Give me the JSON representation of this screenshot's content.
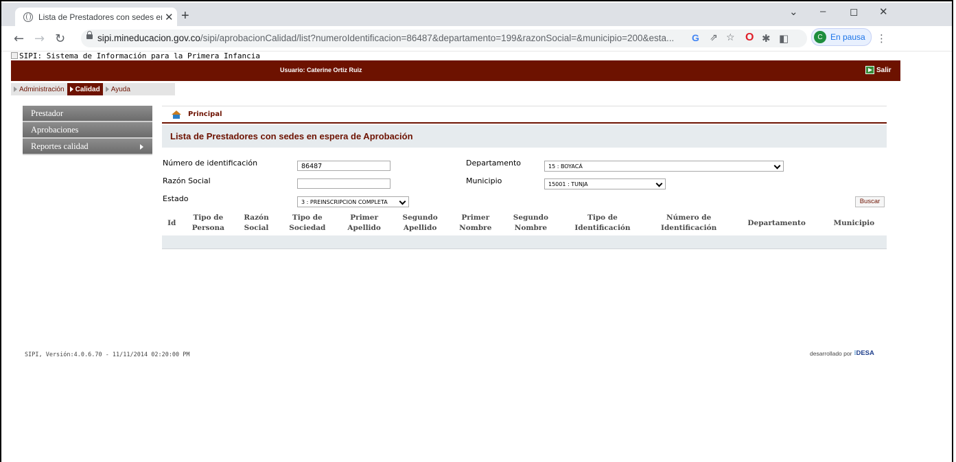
{
  "browser": {
    "tab_title": "Lista de Prestadores con sedes en",
    "tab_close": "✕",
    "new_tab": "+",
    "win_minimize": "–",
    "win_restore": "◻",
    "win_close": "✕",
    "win_chevron": "⌄",
    "url_host": "sipi.mineducacion.gov.co",
    "url_path": "/sipi/aprobacionCalidad/list?numeroIdentificacion=86487&departamento=199&razonSocial=&municipio=200&esta...",
    "profile_initial": "C",
    "profile_status": "En pausa"
  },
  "page": {
    "banner_alt": "SIPI: Sistema de Información para la Primera Infancia",
    "user_label": "Usuario: Caterine Ortiz Ruiz",
    "salir": "Salir",
    "menu": [
      {
        "label": "Administración",
        "active": false
      },
      {
        "label": "Calidad",
        "active": true
      },
      {
        "label": "Ayuda",
        "active": false
      }
    ],
    "sidebar": [
      {
        "label": "Prestador"
      },
      {
        "label": "Aprobaciones"
      },
      {
        "label": "Reportes calidad",
        "has_submenu": true
      }
    ],
    "breadcrumb": "Principal",
    "title": "Lista de Prestadores con sedes en espera de Aprobación",
    "form": {
      "numero_label": "Número de identificación",
      "numero_value": "86487",
      "razon_label": "Razón Social",
      "razon_value": "",
      "estado_label": "Estado",
      "estado_value": "3 : PREINSCRIPCION COMPLETA",
      "departamento_label": "Departamento",
      "departamento_value": "15 : BOYACÁ",
      "municipio_label": "Municipio",
      "municipio_value": "15001 : TUNJA",
      "buscar": "Buscar"
    },
    "table": {
      "columns": [
        [
          "Id"
        ],
        [
          "Tipo de",
          "Persona"
        ],
        [
          "Razón",
          "Social"
        ],
        [
          "Tipo de",
          "Sociedad"
        ],
        [
          "Primer",
          "Apellido"
        ],
        [
          "Segundo",
          "Apellido"
        ],
        [
          "Primer",
          "Nombre"
        ],
        [
          "Segundo",
          "Nombre"
        ],
        [
          "Tipo de",
          "Identificación"
        ],
        [
          "Número de",
          "Identificación"
        ],
        [
          "Departamento"
        ],
        [
          "Municipio"
        ]
      ],
      "rows": []
    },
    "footer_version": "SIPI, Versión:4.0.6.70 - 11/11/2014 02:20:00 PM",
    "footer_dev": "desarrollado por",
    "footer_logo": "DESA"
  }
}
